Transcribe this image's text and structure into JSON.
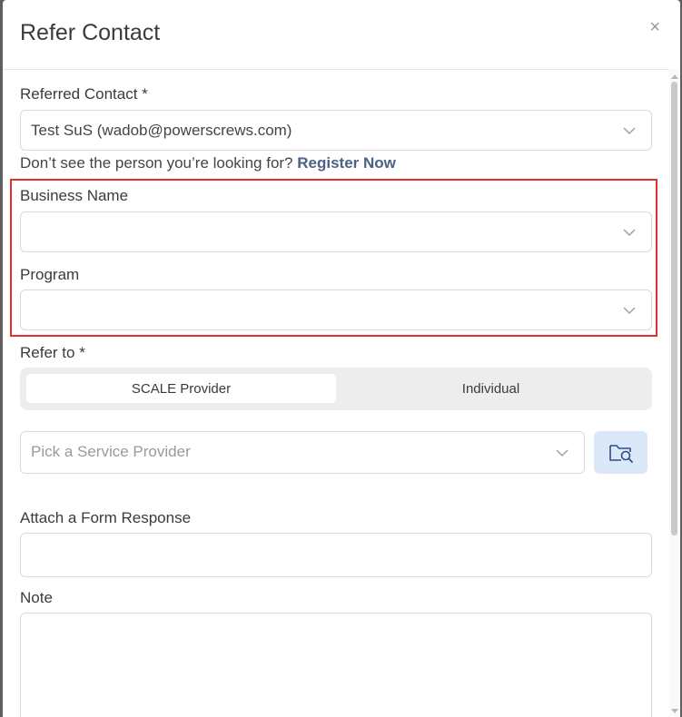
{
  "modal": {
    "title": "Refer Contact",
    "close_label": "×"
  },
  "referred_contact": {
    "label": "Referred Contact *",
    "value": "Test SuS (wadob@powerscrews.com)"
  },
  "helper": {
    "text": "Don’t see the person you’re looking for?",
    "link": "Register Now"
  },
  "business_name": {
    "label": "Business Name",
    "value": ""
  },
  "program": {
    "label": "Program",
    "value": ""
  },
  "refer_to": {
    "label": "Refer to *",
    "options": [
      "SCALE Provider",
      "Individual"
    ],
    "selected": "SCALE Provider"
  },
  "service_provider": {
    "placeholder": "Pick a Service Provider"
  },
  "form_response": {
    "label": "Attach a Form Response",
    "value": ""
  },
  "note": {
    "label": "Note",
    "value": ""
  },
  "colors": {
    "highlight": "#e03030",
    "link": "#4a6286",
    "search_button_bg": "#dbe8f7"
  },
  "icons": {
    "close": "close-icon",
    "dropdown": "chevron-down-icon",
    "search_folder": "folder-search-icon"
  }
}
